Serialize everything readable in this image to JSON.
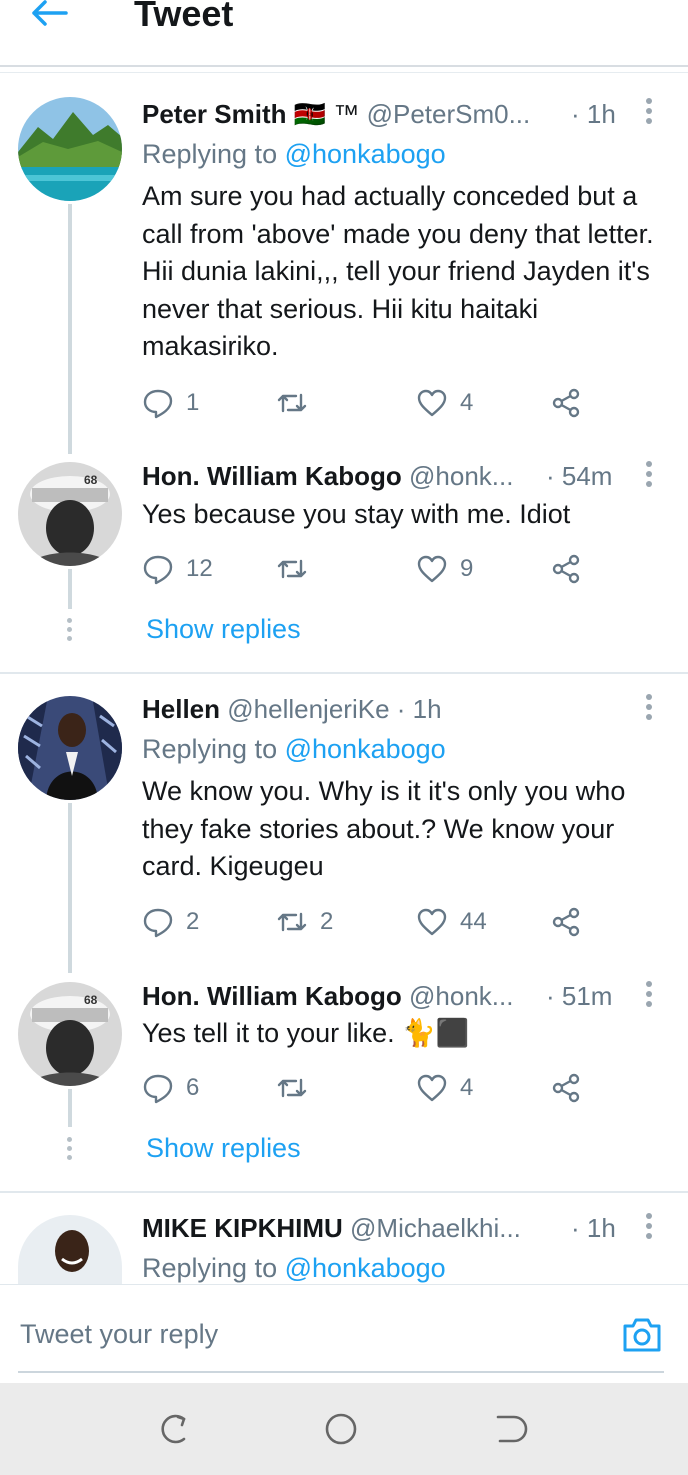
{
  "header": {
    "title": "Tweet"
  },
  "tweets": [
    {
      "name": "Peter Smith",
      "badges": "🇰🇪 ™",
      "handle": "@PeterSm0...",
      "time": "· 1h",
      "replying_prefix": "Replying to",
      "replying_to": "@honkabogo",
      "text": "Am sure you had actually conceded but a call from 'above' made you deny that letter. Hii dunia lakini,,, tell your friend Jayden it's never that serious. Hii kitu haitaki makasiriko.",
      "replies": "1",
      "retweets": "",
      "likes": "4"
    },
    {
      "name": "Hon. William Kabogo",
      "handle": "@honk...",
      "time": "· 54m",
      "text": "Yes because you stay with me. Idiot",
      "replies": "12",
      "retweets": "",
      "likes": "9"
    },
    {
      "name": "Hellen",
      "handle": "@hellenjeriKe",
      "time": "· 1h",
      "replying_prefix": "Replying to",
      "replying_to": "@honkabogo",
      "text": "We know you. Why is it it's only you who they fake stories about.? We know your card. Kigeugeu",
      "replies": "2",
      "retweets": "2",
      "likes": "44"
    },
    {
      "name": "Hon. William Kabogo",
      "handle": "@honk...",
      "time": "· 51m",
      "text": "Yes tell it to your like. 🐈⬛",
      "replies": "6",
      "retweets": "",
      "likes": "4"
    },
    {
      "name": "MIKE KIPKHIMU",
      "handle": "@Michaelkhi...",
      "time": "· 1h",
      "replying_prefix": "Replying to",
      "replying_to": "@honkabogo"
    }
  ],
  "show_replies_label": "Show replies",
  "compose": {
    "placeholder": "Tweet your reply"
  },
  "icons": {
    "back": "arrow-left-icon",
    "reply": "speech-bubble-icon",
    "retweet": "retweet-icon",
    "like": "heart-icon",
    "share": "share-icon",
    "camera": "camera-icon",
    "recent_apps": "recent-apps-icon",
    "home": "home-circle-icon",
    "back_nav": "back-nav-icon"
  },
  "colors": {
    "accent": "#1da1f2",
    "muted": "#657786",
    "text": "#14171a"
  }
}
